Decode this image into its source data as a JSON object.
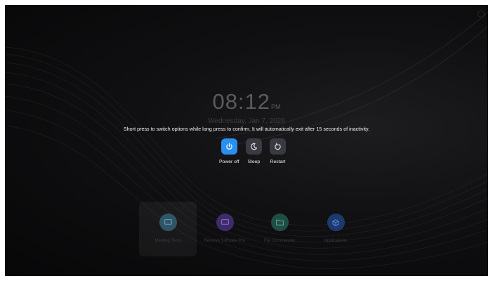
{
  "clock": {
    "time": "08:12",
    "ampm": "PM",
    "date": "Wednesday, Jan 7, 2026"
  },
  "hint": "Short press to switch options while long press to confirm. It will automatically exit after 15 seconds of inactivity.",
  "power_options": [
    {
      "label": "Power off",
      "icon": "power-icon",
      "active": true
    },
    {
      "label": "Sleep",
      "icon": "moon-icon",
      "active": false
    },
    {
      "label": "Restart",
      "icon": "restart-icon",
      "active": false
    }
  ],
  "apps": [
    {
      "name": "Meeting Tools",
      "icon": "screen-icon",
      "color": "#3a6f8a"
    },
    {
      "name": "Reserve Software Pro",
      "icon": "screen-icon",
      "color": "#5b3fa0"
    },
    {
      "name": "File Commander",
      "icon": "folder-icon",
      "color": "#2e7a6a"
    },
    {
      "name": "Applications",
      "icon": "cube-icon",
      "color": "#2c58a8"
    }
  ],
  "colors": {
    "accent": "#2a90f0",
    "button_idle": "#3a3b42",
    "background": "#0b0b0c"
  }
}
